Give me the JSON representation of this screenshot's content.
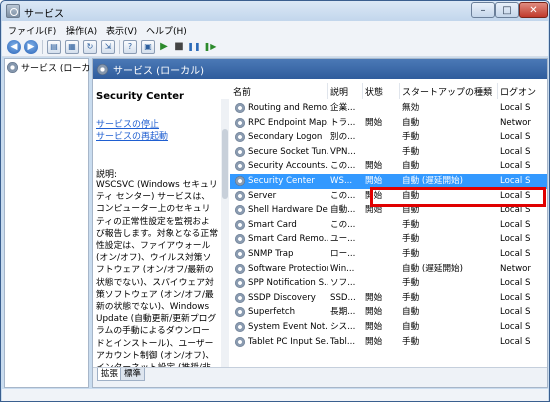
{
  "window": {
    "title": "サービス",
    "buttons": {
      "minimize": "–",
      "maximize": "□",
      "close": "✕"
    }
  },
  "menu": [
    "ファイル(F)",
    "操作(A)",
    "表示(V)",
    "ヘルプ(H)"
  ],
  "toolbar": {
    "back_icon": "back-arrow-icon",
    "forward_icon": "forward-arrow-icon",
    "play_glyph": "▶",
    "stop_glyph": "■",
    "pause_glyph": "❚❚",
    "restart_glyph": "❚▶"
  },
  "tree": {
    "item": "サービス (ローカ"
  },
  "pane": {
    "header": "サービス (ローカル)",
    "selected_service": "Security Center",
    "link_stop": "サービスの停止",
    "link_restart": "サービスの再起動",
    "desc_label": "説明:",
    "desc_body": "WSCSVC (Windows セキュリティ センター) サービスは、コンピューター上のセキュリティの正常性設定を監視および報告します。対象となる正常性設定は、ファイアウォール (オン/オフ)、ウイルス対策ソフトウェア (オン/オフ/最新の状態でない)、スパイウェア対策ソフトウェア (オン/オフ/最新の状態でない)、Windows Update (自動更新/更新プログラムの手動によるダウンロードとインストール)、ユーザー アカウント制御 (オン/オフ)、インターネット設定 (推奨/非推奨) などです。このサービスが提供する"
  },
  "table": {
    "columns": [
      "名前",
      "説明",
      "状態",
      "スタートアップの種類",
      "ログオン"
    ],
    "rows": [
      {
        "name": "Routing and Remo...",
        "desc": "企業...",
        "status": "",
        "startup": "無効",
        "logon": "Local S"
      },
      {
        "name": "RPC Endpoint Map...",
        "desc": "トラ...",
        "status": "開始",
        "startup": "自動",
        "logon": "Networ"
      },
      {
        "name": "Secondary Logon",
        "desc": "別の...",
        "status": "",
        "startup": "手動",
        "logon": "Local S"
      },
      {
        "name": "Secure Socket Tun...",
        "desc": "VPN...",
        "status": "",
        "startup": "手動",
        "logon": "Local S"
      },
      {
        "name": "Security Accounts...",
        "desc": "この...",
        "status": "開始",
        "startup": "自動",
        "logon": "Local S"
      },
      {
        "name": "Security Center",
        "desc": "WS...",
        "status": "開始",
        "startup": "自動 (遅延開始)",
        "logon": "Local S",
        "selected": true
      },
      {
        "name": "Server",
        "desc": "この...",
        "status": "開始",
        "startup": "自動",
        "logon": "Local S"
      },
      {
        "name": "Shell Hardware De...",
        "desc": "自動...",
        "status": "開始",
        "startup": "自動",
        "logon": "Local S"
      },
      {
        "name": "Smart Card",
        "desc": "この...",
        "status": "",
        "startup": "手動",
        "logon": "Local S"
      },
      {
        "name": "Smart Card Remo...",
        "desc": "ユー...",
        "status": "",
        "startup": "手動",
        "logon": "Local S"
      },
      {
        "name": "SNMP Trap",
        "desc": "ロー...",
        "status": "",
        "startup": "手動",
        "logon": "Local S"
      },
      {
        "name": "Software Protection",
        "desc": "Win...",
        "status": "",
        "startup": "自動 (遅延開始)",
        "logon": "Networ"
      },
      {
        "name": "SPP Notification S...",
        "desc": "ソフ...",
        "status": "",
        "startup": "手動",
        "logon": "Local S"
      },
      {
        "name": "SSDP Discovery",
        "desc": "SSD...",
        "status": "開始",
        "startup": "手動",
        "logon": "Local S"
      },
      {
        "name": "Superfetch",
        "desc": "長期...",
        "status": "開始",
        "startup": "自動",
        "logon": "Local S"
      },
      {
        "name": "System Event Not...",
        "desc": "シス...",
        "status": "開始",
        "startup": "自動",
        "logon": "Local S"
      },
      {
        "name": "Tablet PC Input Se...",
        "desc": "Tabl...",
        "status": "開始",
        "startup": "手動",
        "logon": "Local S"
      }
    ]
  },
  "tabs": [
    "拡張",
    "標準"
  ],
  "colors": {
    "selection": "#3399ff",
    "highlight_box": "#e00000",
    "header": "#3a69a8"
  }
}
